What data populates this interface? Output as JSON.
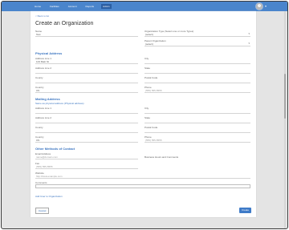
{
  "nav": {
    "items": [
      {
        "label": "Home"
      },
      {
        "label": "Facilities"
      },
      {
        "label": "Account"
      },
      {
        "label": "Reports"
      },
      {
        "label": "Admin"
      }
    ]
  },
  "breadcrumb": "< Back to list",
  "page_title": "Create an Organization",
  "form": {
    "name_label": "Name",
    "name_value": "Test",
    "org_type_label": "Organization Type (Select one or more Types)",
    "org_type_value": "(select)",
    "parent_label": "Parent Organization",
    "parent_value": "(select)",
    "physical": {
      "title": "Physical Address",
      "address1_label": "Address Line 1",
      "address1_value": "123 Main St",
      "address2_label": "Address Line 2",
      "city_label": "City",
      "state_label": "State",
      "postal_label": "Postal Code",
      "county_label": "County",
      "country_label": "Country",
      "country_value": "US",
      "phone_label": "Phone",
      "phone_placeholder": "(555) 555-5555"
    },
    "mailing": {
      "title": "Mailing Address",
      "same_note": "Same as physical address (Physical address)",
      "address1_label": "Address Line 1",
      "address2_label": "Address Line 2",
      "city_label": "City",
      "state_label": "State",
      "postal_label": "Postal Code",
      "county_label": "County",
      "country_label": "Country",
      "country_value": "US",
      "phone_label": "Phone",
      "phone_placeholder": "(555) 555-5555"
    },
    "contact": {
      "title": "Other Methods of Contact",
      "email_label": "Email Address",
      "email_placeholder": "name@domain.com",
      "fax_label": "Fax",
      "fax_placeholder": "(555) 555-5555",
      "website_label": "Website",
      "website_placeholder": "http://www.example.com",
      "comments_label": "Comments",
      "business_hours_label": "Business Hours and Comments"
    },
    "add_user_link": "Add User to Organization",
    "cancel_label": "Cancel",
    "submit_label": "Create"
  }
}
